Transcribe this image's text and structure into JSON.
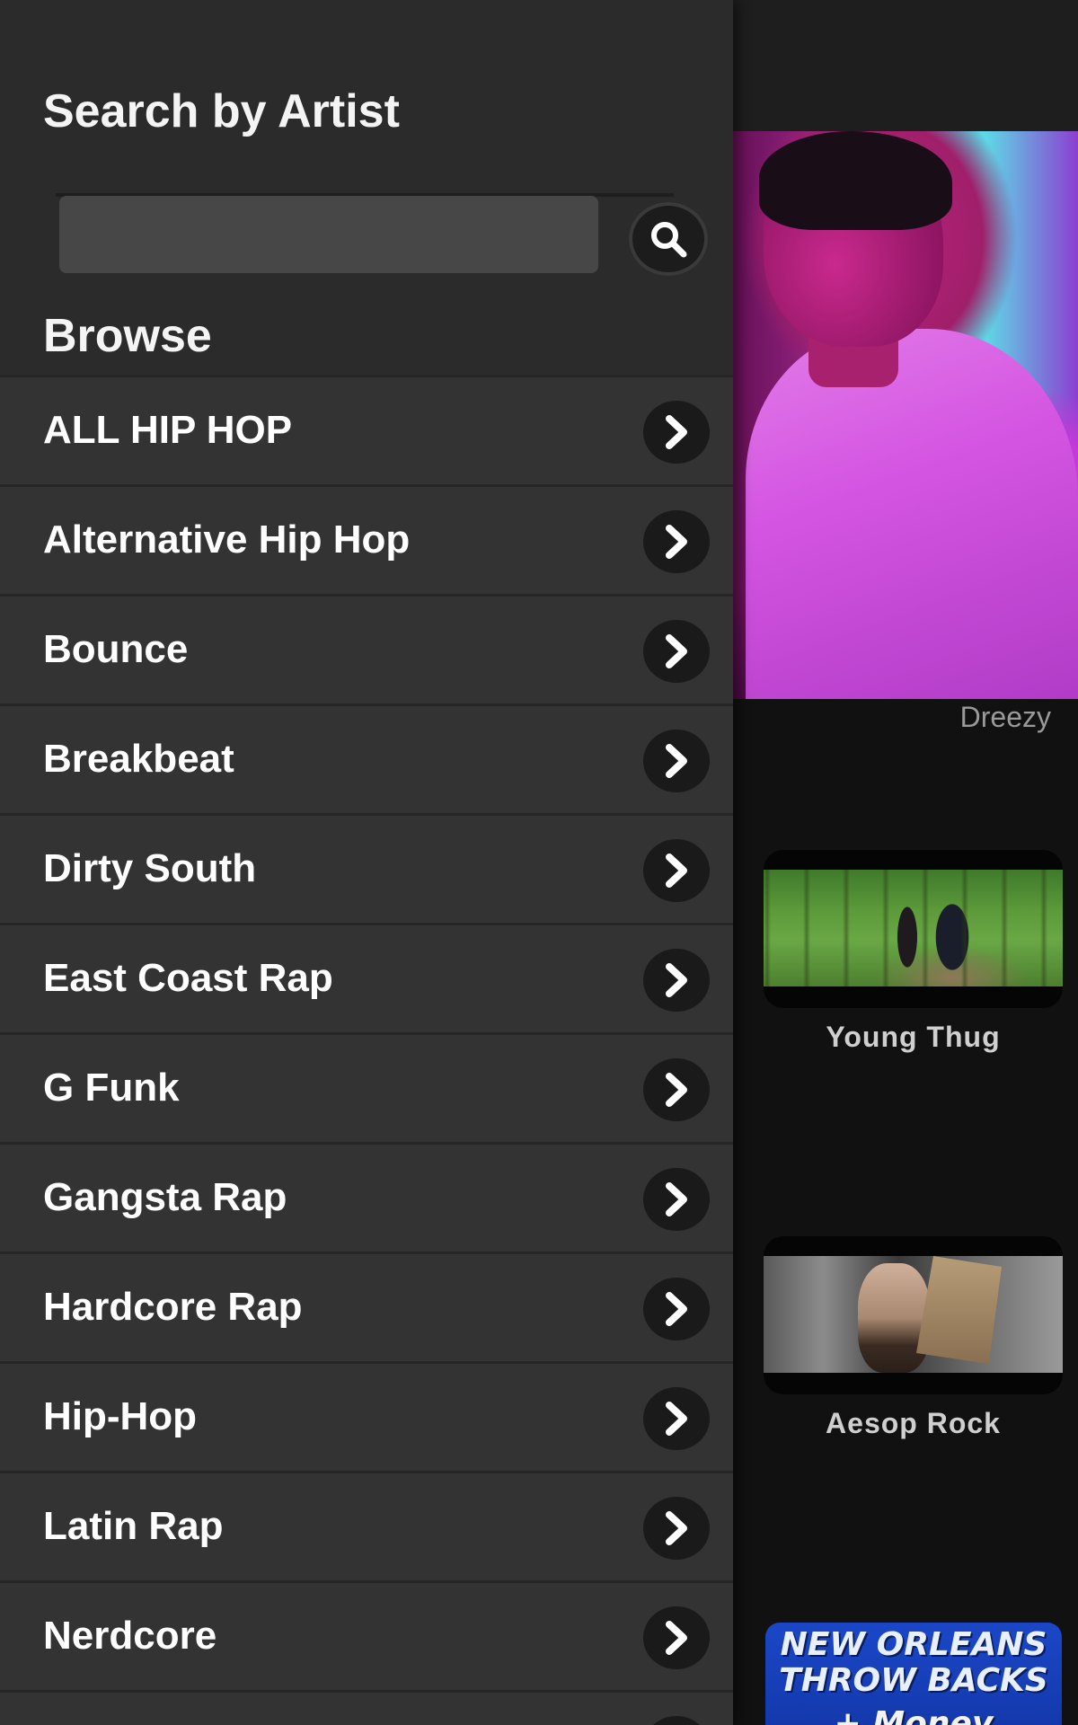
{
  "drawer": {
    "title": "Search by Artist",
    "search": {
      "value": "",
      "placeholder": ""
    },
    "browse_title": "Browse",
    "browse_items": [
      "ALL HIP HOP",
      "Alternative Hip Hop",
      "Bounce",
      "Breakbeat",
      "Dirty South",
      "East Coast Rap",
      "G Funk",
      "Gangsta Rap",
      "Hardcore Rap",
      "Hip-Hop",
      "Latin Rap",
      "Nerdcore",
      ""
    ]
  },
  "background": {
    "featured": {
      "caption": "Dreezy"
    },
    "videos": [
      {
        "title": "Young Thug"
      },
      {
        "title": "Aesop Rock"
      }
    ],
    "ad": {
      "line1": "NEW ORLEANS",
      "line2": "THROW BACKS",
      "line3": "+ Money"
    }
  },
  "colors": {
    "drawer_bg": "#2b2b2b",
    "row_bg": "#333333",
    "page_bg": "#111111",
    "text_primary": "#ffffff",
    "caption_gray": "#9a9a9a"
  },
  "icons": {
    "search": "search-icon",
    "row_arrow": "chevron-right-icon"
  }
}
